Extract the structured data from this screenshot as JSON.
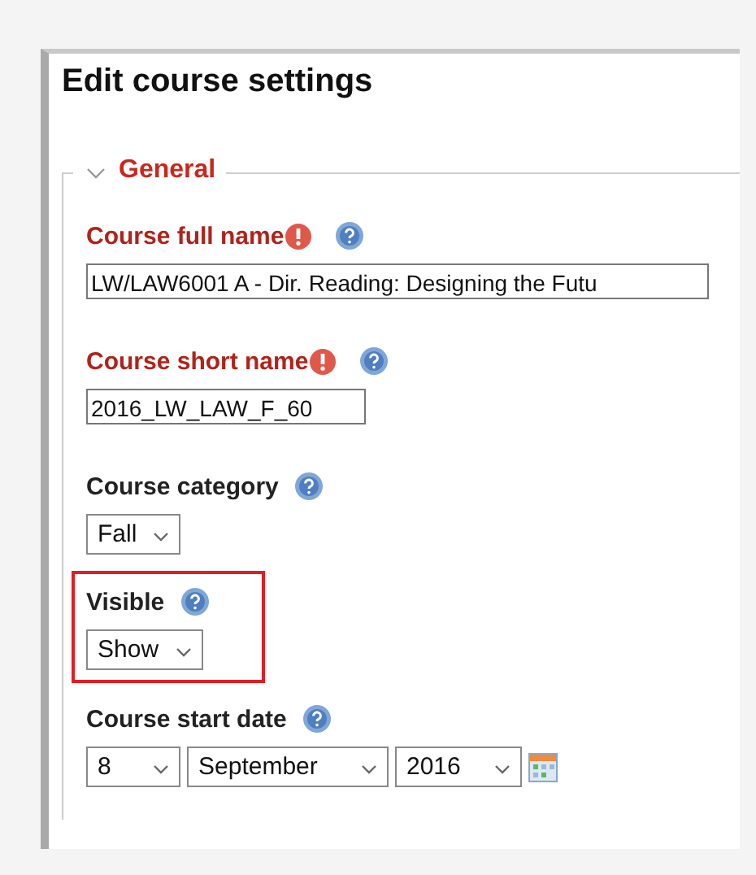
{
  "title": "Edit course settings",
  "section": {
    "legend": "General",
    "expanded": true
  },
  "fields": [
    {
      "kind": "text",
      "label": "Course full name",
      "required": true,
      "highlighted": false,
      "value": "LW/LAW6001 A - Dir. Reading: Designing the Futu"
    },
    {
      "kind": "text",
      "label": "Course short name",
      "required": true,
      "highlighted": false,
      "value": "2016_LW_LAW_F_60"
    },
    {
      "kind": "select",
      "label": "Course category",
      "required": false,
      "highlighted": false,
      "value": "Fall"
    },
    {
      "kind": "select",
      "label": "Visible",
      "required": false,
      "highlighted": true,
      "value": "Show"
    },
    {
      "kind": "date",
      "label": "Course start date",
      "required": false,
      "highlighted": false,
      "day": "8",
      "month": "September",
      "year": "2016"
    }
  ]
}
